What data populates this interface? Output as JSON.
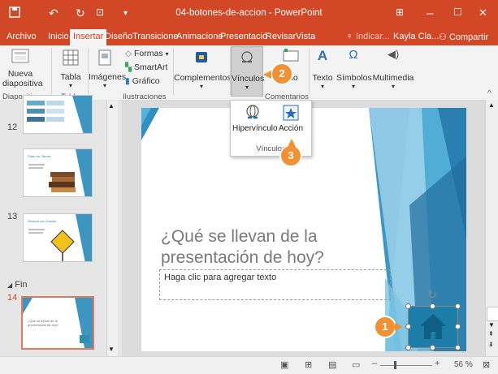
{
  "window": {
    "title": "04-botones-de-accion - PowerPoint"
  },
  "tabs": [
    "Archivo",
    "Inicio",
    "Insertar",
    "Diseño",
    "Transicione",
    "Animacione",
    "Presentació",
    "Revisar",
    "Vista"
  ],
  "active_tab": "Insertar",
  "tell_me": "Indicar...",
  "user": "Kayla Cla...",
  "share": "Compartir",
  "ribbon": {
    "nueva_line1": "Nueva",
    "nueva_line2": "diapositiva",
    "tabla": "Tabla",
    "imagenes": "Imágenes",
    "formas": "Formas",
    "smartart": "SmartArt",
    "grafico": "Gráfico",
    "complementos": "Complementos",
    "vinculos": "Vínculos",
    "comentario_partial": "ario",
    "texto": "Texto",
    "simbolos": "Símbolos",
    "multimedia": "Multimedia",
    "groups": {
      "diapositivas": "Diapositivas",
      "tablas": "Tablas",
      "ilustraciones": "Ilustraciones",
      "comentarios": "Comentarios"
    }
  },
  "dropdown": {
    "hipervinculo": "Hipervínculo",
    "accion": "Acción",
    "group": "Vínculos"
  },
  "thumbnails": [
    {
      "num": "",
      "title": ""
    },
    {
      "num": "12",
      "title": "Flash vs. Tanda"
    },
    {
      "num": "13",
      "title": "Sembra con l'uscita"
    },
    {
      "num": "14",
      "title": "¿Qué se llevan de la presentación de hoy?"
    }
  ],
  "section": "Fin",
  "slide": {
    "title": "¿Qué se llevan de la presentación de hoy?",
    "placeholder": "Haga clic para agregar texto"
  },
  "callouts": [
    "1",
    "2",
    "3"
  ],
  "status": {
    "zoom": "56 %"
  },
  "colors": {
    "accent": "#d24726",
    "callout": "#f19133",
    "slide_teal": "#2e8fb0"
  }
}
